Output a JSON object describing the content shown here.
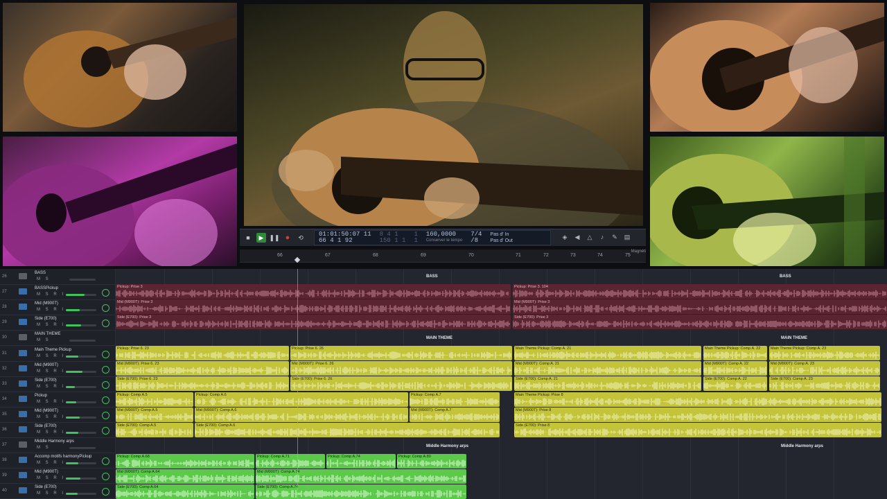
{
  "videos": [
    {
      "name": "video-top-left"
    },
    {
      "name": "video-bottom-left"
    },
    {
      "name": "video-center"
    },
    {
      "name": "video-top-right"
    },
    {
      "name": "video-bottom-right"
    }
  ],
  "transport": {
    "position_time": "01:01:50:07 11",
    "position_bars": "66  4  1    92",
    "time_sub_a": "8  4  1",
    "time_sub_b": "150  1  1",
    "tempo_digit_a": "1",
    "tempo_digit_b": "1",
    "tempo": "160,0000",
    "tempo_sub": "Conserver le tempo",
    "sig_top": "7/4",
    "sig_bottom": "/8",
    "pas_in": "Pas d' In",
    "pas_out": "Pas d' Out"
  },
  "ruler": {
    "bars": [
      "66",
      "67",
      "68",
      "69",
      "70",
      "71",
      "72",
      "73",
      "74",
      "75"
    ],
    "magnetism": "Magnéti"
  },
  "tracks": [
    {
      "num": "26",
      "name": "BASS",
      "msr": "M S"
    },
    {
      "num": "27",
      "name": "BASSPickup",
      "msr": "M S R I"
    },
    {
      "num": "28",
      "name": "Mid (M900T)",
      "msr": "M S R I"
    },
    {
      "num": "29",
      "name": "Side (E700)",
      "msr": "M S R I"
    },
    {
      "num": "30",
      "name": "MAIN THEME",
      "msr": "M S"
    },
    {
      "num": "31",
      "name": "Main Theme Pickup",
      "msr": "M S R I"
    },
    {
      "num": "32",
      "name": "Mid (M900T)",
      "msr": "M S R I"
    },
    {
      "num": "33",
      "name": "Side (E700)",
      "msr": "M S R I"
    },
    {
      "num": "34",
      "name": "Pickup",
      "msr": "M S R I"
    },
    {
      "num": "35",
      "name": "Mid (M900T)",
      "msr": "M S R I"
    },
    {
      "num": "36",
      "name": "Side (E700)",
      "msr": "M S R I"
    },
    {
      "num": "37",
      "name": "Middle Harmony arps",
      "msr": "M S"
    },
    {
      "num": "38",
      "name": "Accomp motifs harmonyPickup",
      "msr": "M S R I"
    },
    {
      "num": "39",
      "name": "Mid (M900T)",
      "msr": "M S R I"
    },
    {
      "num": "40",
      "name": "Side (E700)",
      "msr": "M S R I"
    }
  ],
  "folders": {
    "bass": "BASS",
    "main_theme": "MAIN THEME",
    "middle": "Middle Harmony arps"
  },
  "region_labels": {
    "bass_pickup": "Pickup: Prise 3",
    "bass_pickup_b": "Pickup: Prise 3. 104",
    "bass_mid": "Mid (M900T): Prise 3",
    "bass_side": "Side (E700): Prise 3",
    "theme_pickup_a": "Pickup: Prise 6. 23",
    "theme_pickup_b": "Pickup: Prise 6. 26",
    "theme_pickup_c": "Main Theme Pickup: Comp A. 21",
    "theme_pickup_d": "Main Theme Pickup: Comp A. 22",
    "theme_pickup_e": "Main Theme Pickup: Comp A. 23",
    "theme_mid_a": "Mid (M900T): Prise 6. 23",
    "theme_mid_b": "Mid (M900T): Prise 6. 26",
    "theme_mid_c": "Mid (M900T): Comp A. 21",
    "theme_mid_d": "Mid (M900T): Comp A. 22",
    "theme_mid_e": "Mid (M900T): Comp A. 23",
    "theme_side_a": "Side (E700): Prise 6. 23",
    "theme_side_b": "Side (E700): Prise 6. 26",
    "theme_side_c": "Side (E700): Comp A. 21",
    "theme_side_d": "Side (E700): Comp A. 22",
    "theme_side_e": "Side (E700): Comp A. 23",
    "pickup_a": "Pickup: Comp A.5",
    "pickup_b": "Pickup: Comp A.6",
    "pickup_c": "Pickup: Comp A.7",
    "pickup_d": "Main Theme Pickup: Prise 8",
    "pickup_mid_a": "Mid (M900T): Comp A.5",
    "pickup_mid_b": "Mid (M900T): Comp A.6",
    "pickup_mid_c": "Mid (M900T): Comp A.7",
    "pickup_mid_d": "Mid (M900T): Prise 8",
    "pickup_side_a": "Side (E700): Comp A.5",
    "pickup_side_b": "Side (E700): Comp A.6",
    "pickup_side_c": "Side (E700): Prise 8",
    "mid_pickup_a": "Pickup: Comp A.68",
    "mid_pickup_b": "Pickup: Comp A.71",
    "mid_pickup_c": "Pickup: Comp A.74",
    "mid_pickup_d": "Pickup: Comp A.80",
    "mid_mid_a": "Mid (M900T): Comp A.64",
    "mid_mid_b": "Mid (M900T): Comp A.74",
    "mid_side_a": "Side (E700): Comp A.64",
    "mid_side_b": "Side (E700): Comp A.74"
  }
}
